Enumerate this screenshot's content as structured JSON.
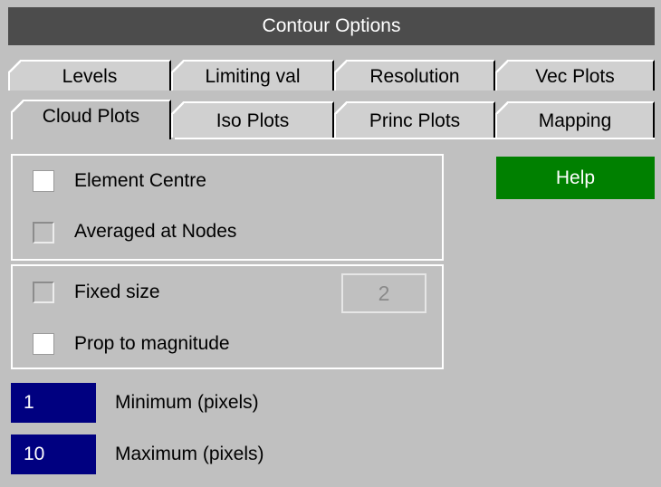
{
  "window": {
    "title": "Contour Options"
  },
  "tabs": {
    "row1": [
      "Levels",
      "Limiting val",
      "Resolution",
      "Vec Plots"
    ],
    "row2": [
      "Cloud Plots",
      "Iso Plots",
      "Princ Plots",
      "Mapping"
    ],
    "active": "Cloud Plots"
  },
  "position_group": {
    "element_centre": {
      "label": "Element Centre",
      "checked": true
    },
    "averaged_at_nodes": {
      "label": "Averaged at Nodes",
      "checked": false
    }
  },
  "size_group": {
    "fixed_size": {
      "label": "Fixed size",
      "checked": false,
      "value": "2"
    },
    "prop_to_magnitude": {
      "label": "Prop to magnitude",
      "checked": true
    }
  },
  "help_button": {
    "label": "Help"
  },
  "minimum": {
    "value": "1",
    "label": "Minimum (pixels)"
  },
  "maximum": {
    "value": "10",
    "label": "Maximum (pixels)"
  },
  "colors": {
    "title_bg": "#4c4c4c",
    "help_bg": "#008000",
    "value_box_bg": "#000080",
    "panel_bg": "#c0c0c0"
  }
}
